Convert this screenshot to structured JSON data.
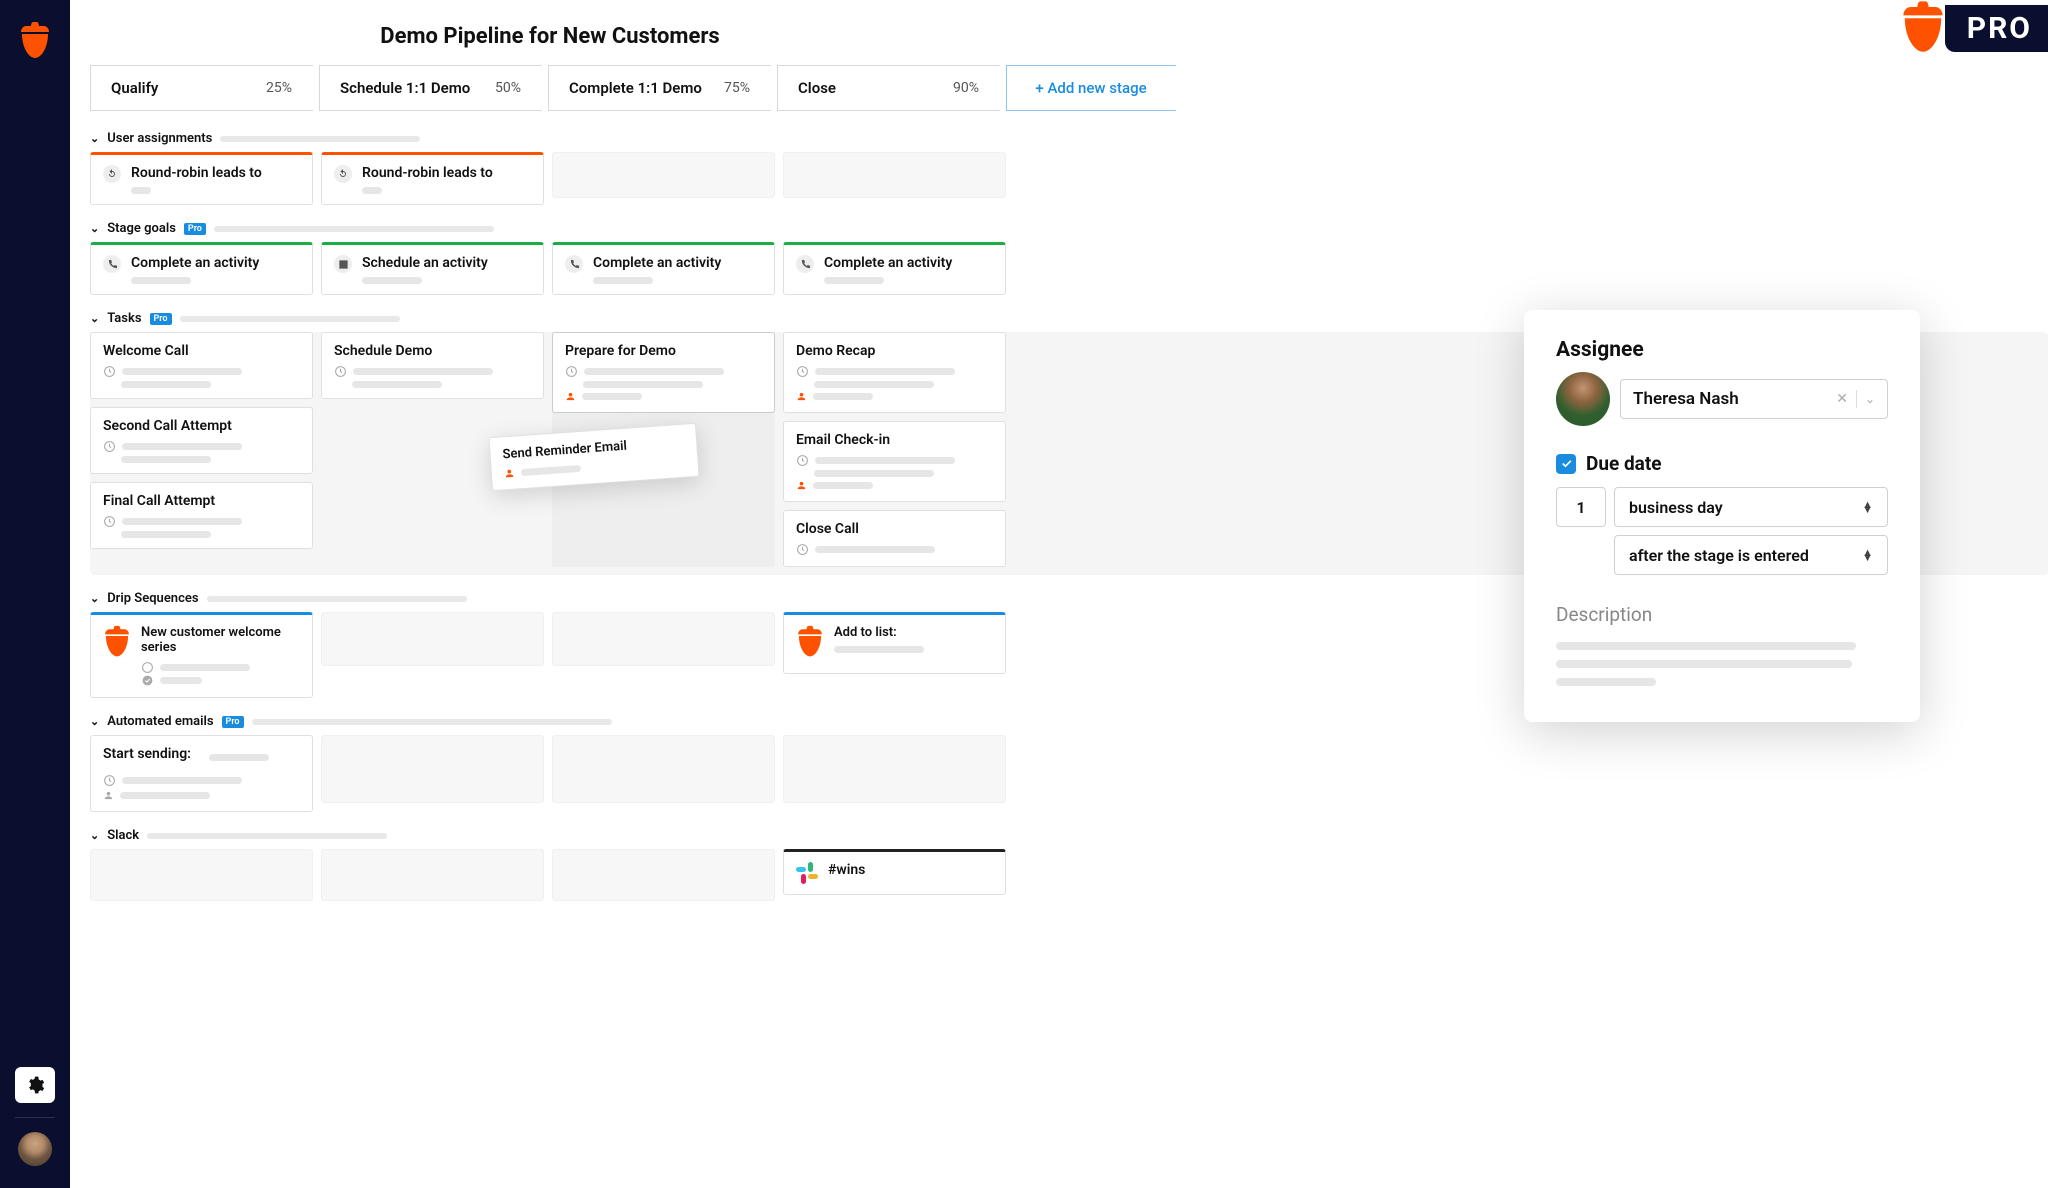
{
  "brand": {
    "pro_label": "PRO"
  },
  "page": {
    "title": "Demo Pipeline for New Customers"
  },
  "stages": [
    {
      "name": "Qualify",
      "pct": "25%"
    },
    {
      "name": "Schedule 1:1 Demo",
      "pct": "50%"
    },
    {
      "name": "Complete 1:1 Demo",
      "pct": "75%"
    },
    {
      "name": "Close",
      "pct": "90%"
    }
  ],
  "add_stage_label": "+ Add new stage",
  "sections": {
    "user_assignments": {
      "title": "User assignments"
    },
    "stage_goals": {
      "title": "Stage goals",
      "pro": "Pro"
    },
    "tasks": {
      "title": "Tasks",
      "pro": "Pro"
    },
    "drip": {
      "title": "Drip Sequences"
    },
    "automated_emails": {
      "title": "Automated emails",
      "pro": "Pro"
    },
    "slack": {
      "title": "Slack"
    }
  },
  "user_assignments": {
    "card_title": "Round-robin leads to"
  },
  "stage_goals": {
    "complete": "Complete an activity",
    "schedule": "Schedule an activity"
  },
  "tasks": {
    "col1": [
      "Welcome Call",
      "Second Call Attempt",
      "Final Call Attempt"
    ],
    "col2": [
      "Schedule Demo"
    ],
    "col3": [
      "Prepare for Demo"
    ],
    "col4": [
      "Demo Recap",
      "Email Check-in",
      "Close Call"
    ],
    "dragging": "Send Reminder Email"
  },
  "drip": {
    "card1": "New customer welcome series",
    "card4": "Add to list:"
  },
  "automated_emails": {
    "card1": "Start sending:"
  },
  "slack": {
    "channel": "#wins"
  },
  "panel": {
    "assignee_label": "Assignee",
    "assignee_name": "Theresa Nash",
    "due_label": "Due date",
    "due_number": "1",
    "due_unit": "business day",
    "due_relative": "after the stage is entered",
    "description_label": "Description"
  }
}
